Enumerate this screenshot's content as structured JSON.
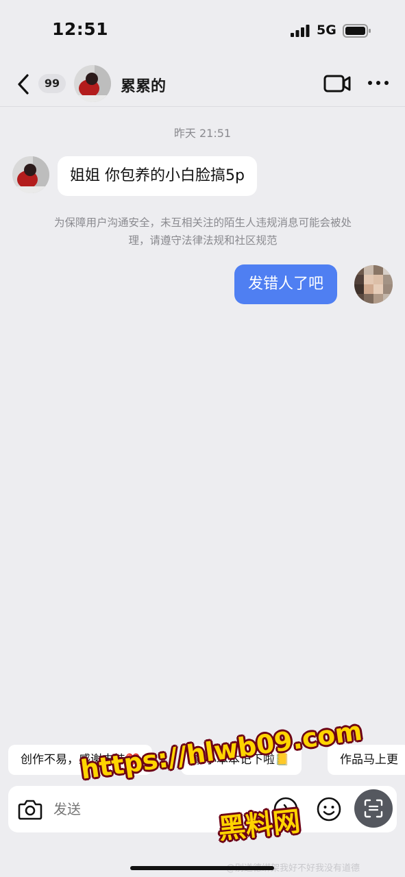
{
  "status_bar": {
    "time": "12:51",
    "network": "5G",
    "icons": [
      "signal-icon",
      "battery-icon"
    ]
  },
  "nav": {
    "unread_count": "99",
    "contact_name": "累累的",
    "icons": [
      "back-icon",
      "video-call-icon",
      "more-icon"
    ]
  },
  "chat": {
    "timestamp": "昨天 21:51",
    "incoming_message": "姐姐 你包养的小白脸搞5p",
    "notice": "为保障用户沟通安全，未互相关注的陌生人违规消息可能会被处理，请遵守法律法规和社区规范",
    "outgoing_message": "发错人了吧"
  },
  "quick_replies": [
    "创作不易，感谢支持❤️",
    "拿小本本记下啦📒",
    "作品马上更"
  ],
  "input": {
    "placeholder": "发送",
    "icons": [
      "camera-icon",
      "voice-icon",
      "emoji-icon",
      "scan-icon"
    ]
  },
  "watermark": {
    "url": "https://hlwb09.com",
    "brand": "黑料网",
    "weibo": "@别道德绑架我好不好我没有道德"
  },
  "colors": {
    "background": "#ededf0",
    "outgoing_bubble": "#4f7ff2",
    "incoming_bubble": "#ffffff",
    "watermark_fill": "#ffd400",
    "watermark_stroke": "#6b0015"
  }
}
